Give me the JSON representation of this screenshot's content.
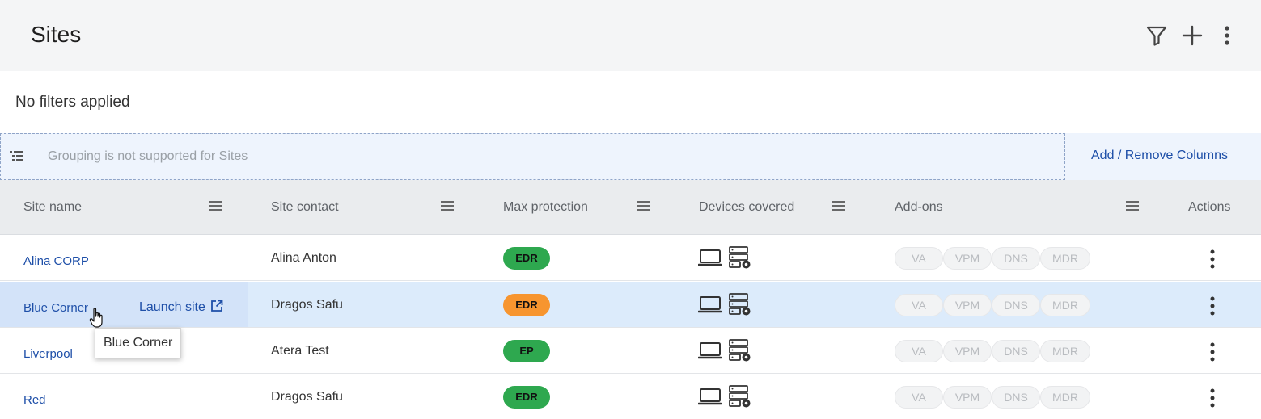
{
  "header": {
    "title": "Sites"
  },
  "toolbar": {
    "filter_icon": "filter-icon",
    "add_icon": "plus-icon",
    "more_icon": "more-vertical-icon"
  },
  "filter_status": "No filters applied",
  "grouping": {
    "placeholder": "Grouping is not supported for Sites",
    "icon": "group-list-icon"
  },
  "columns_link": "Add / Remove Columns",
  "table": {
    "headers": {
      "site_name": "Site name",
      "site_contact": "Site contact",
      "max_protection": "Max protection",
      "devices_covered": "Devices covered",
      "addons": "Add-ons",
      "actions": "Actions"
    },
    "addon_labels": [
      "VA",
      "VPM",
      "DNS",
      "MDR"
    ],
    "rows": [
      {
        "site_name": "Alina CORP",
        "site_contact": "Alina Anton",
        "max_protection": "EDR",
        "badge_color": "#2ea84f"
      },
      {
        "site_name": "Blue Corner",
        "site_contact": "Dragos Safu",
        "max_protection": "EDR",
        "badge_color": "#f7952f",
        "hovered": true
      },
      {
        "site_name": "Liverpool",
        "site_contact": "Atera Test",
        "max_protection": "EP",
        "badge_color": "#2ea84f"
      },
      {
        "site_name": "Red",
        "site_contact": "Dragos Safu",
        "max_protection": "EDR",
        "badge_color": "#2ea84f"
      }
    ]
  },
  "hover": {
    "launch_label": "Launch site",
    "tooltip": "Blue Corner"
  },
  "colors": {
    "link": "#1e4fa8",
    "header_bg": "#f4f5f6",
    "hover_row": "#dcebfb",
    "edr_green": "#2ea84f",
    "edr_orange": "#f7952f"
  }
}
